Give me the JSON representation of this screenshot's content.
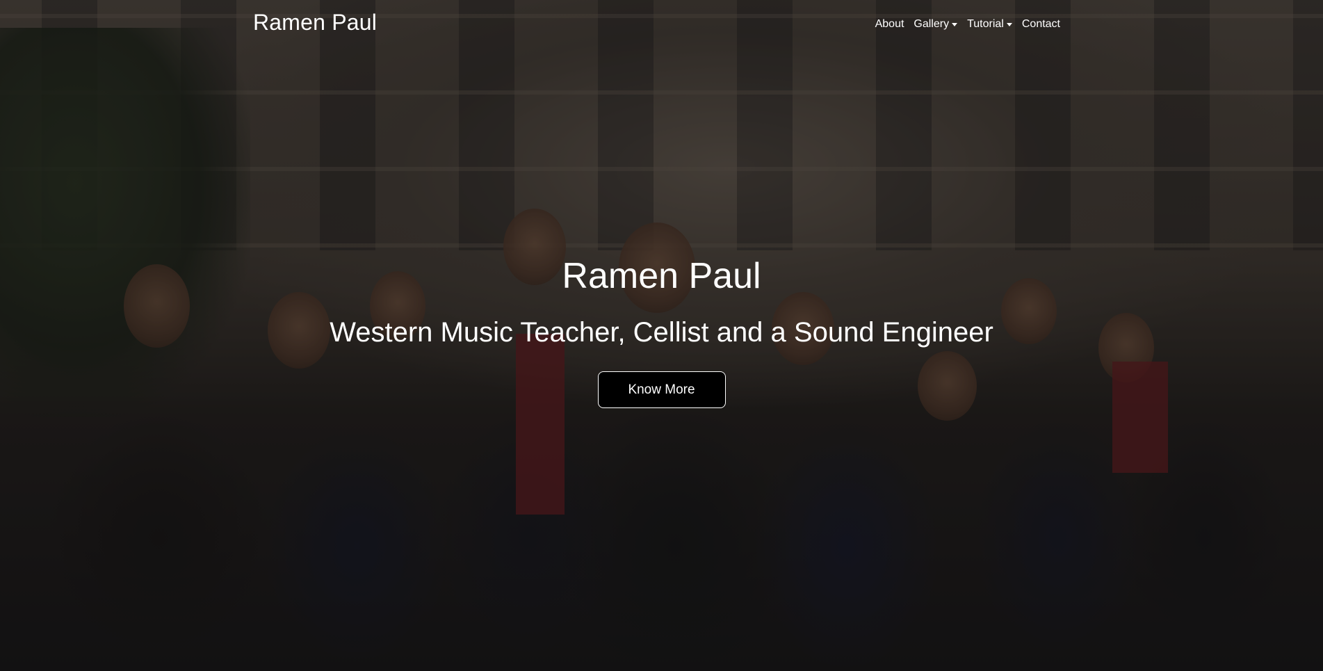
{
  "navbar": {
    "brand": "Ramen Paul",
    "items": [
      {
        "label": "About",
        "dropdown": false
      },
      {
        "label": "Gallery",
        "dropdown": true
      },
      {
        "label": "Tutorial",
        "dropdown": true
      },
      {
        "label": "Contact",
        "dropdown": false
      }
    ]
  },
  "hero": {
    "title": "Ramen Paul",
    "subtitle": "Western Music Teacher, Cellist and a Sound Engineer",
    "button_label": "Know More"
  },
  "colors": {
    "text": "#ffffff",
    "button_bg": "#000000",
    "overlay": "rgba(0,0,0,0.38)"
  }
}
